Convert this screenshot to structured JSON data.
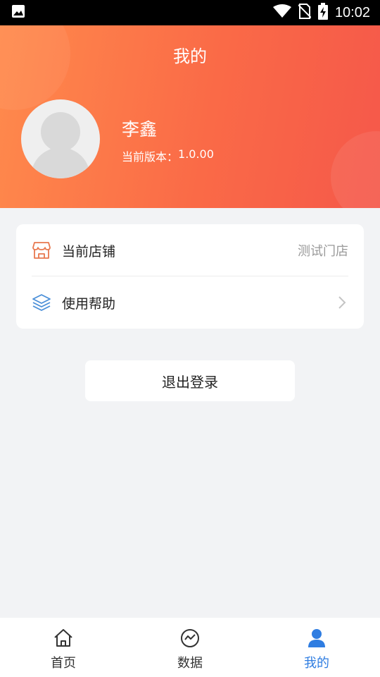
{
  "status_bar": {
    "time": "10:02",
    "icons": [
      "image-icon",
      "wifi-icon",
      "no-sim-icon",
      "battery-charging-icon"
    ]
  },
  "header": {
    "title": "我的",
    "user_name": "李鑫",
    "version_label": "当前版本：",
    "version_value": "1.0.00"
  },
  "menu": {
    "items": [
      {
        "icon": "store-icon",
        "label": "当前店铺",
        "value": "测试门店"
      },
      {
        "icon": "layers-icon",
        "label": "使用帮助",
        "value": ""
      }
    ]
  },
  "logout": {
    "label": "退出登录"
  },
  "tabbar": {
    "tabs": [
      {
        "icon": "home-icon",
        "label": "首页",
        "active": false
      },
      {
        "icon": "data-chart-icon",
        "label": "数据",
        "active": false
      },
      {
        "icon": "user-icon",
        "label": "我的",
        "active": true
      }
    ]
  },
  "colors": {
    "header_gradient_start": "#ff8a4c",
    "header_gradient_end": "#f5584a",
    "active_tab": "#2f7de1",
    "store_icon": "#e8784f",
    "layers_icon": "#4a8fd8"
  }
}
